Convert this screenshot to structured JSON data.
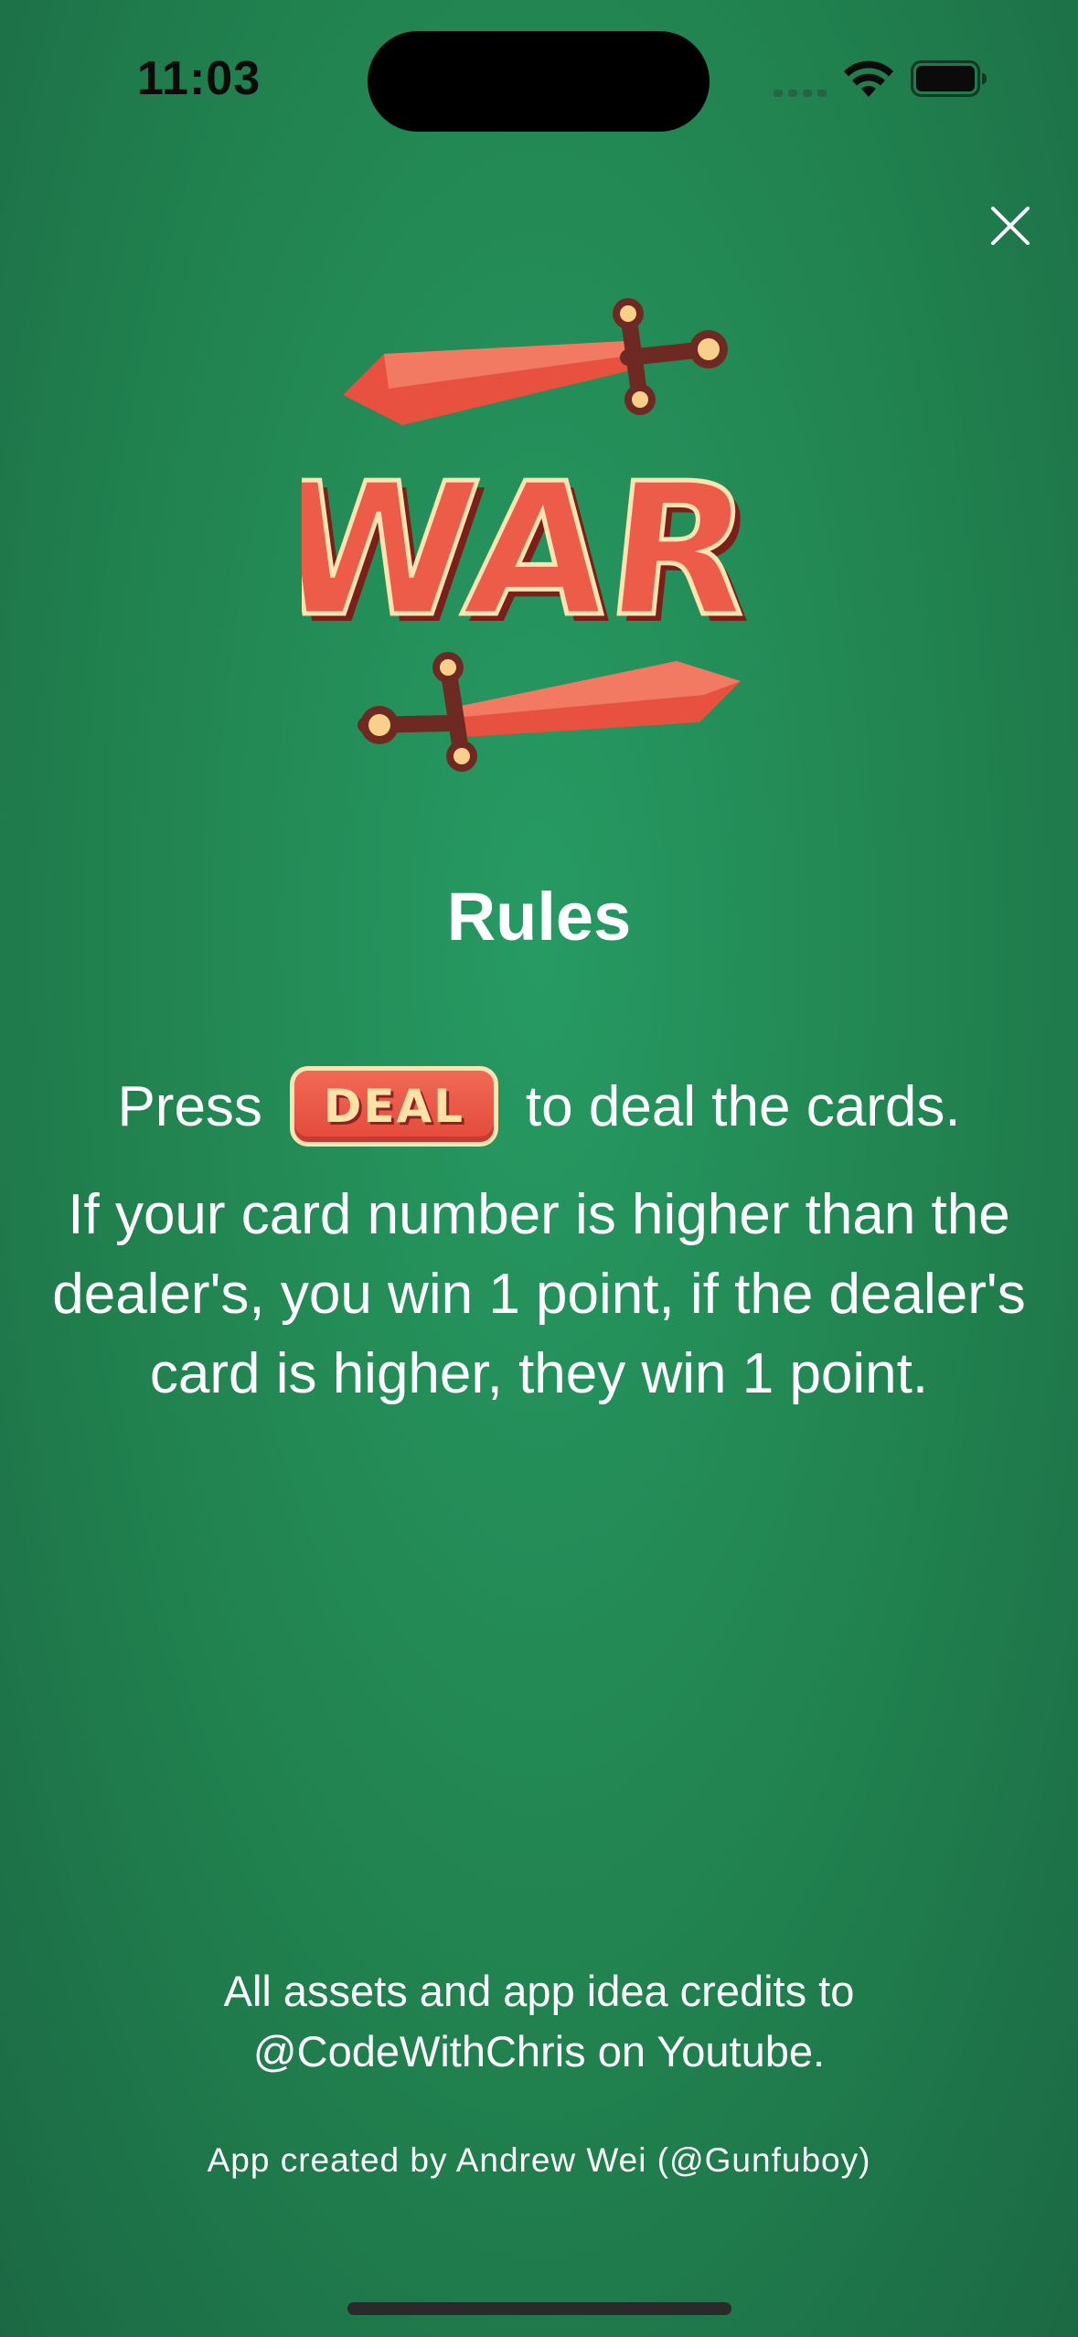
{
  "status_bar": {
    "time": "11:03"
  },
  "close_button": {
    "icon": "close-icon"
  },
  "logo": {
    "text": "WAR",
    "icon": "war-logo-swords"
  },
  "rules": {
    "title": "Rules",
    "press_prefix": "Press",
    "deal_badge": "DEAL",
    "press_suffix": "to deal the cards.",
    "body": "If your card number is higher than the dealer's, you win 1 point, if the dealer's card is higher, they win 1 point."
  },
  "credits": {
    "line1": "All assets and app idea credits to",
    "line2": "@CodeWithChris on Youtube.",
    "created_by": "App created by Andrew Wei (@Gunfuboy)"
  },
  "colors": {
    "background": "#23885a",
    "accent_red": "#e4493c",
    "cream": "#fde2a7",
    "dark_red": "#6e2a22"
  }
}
